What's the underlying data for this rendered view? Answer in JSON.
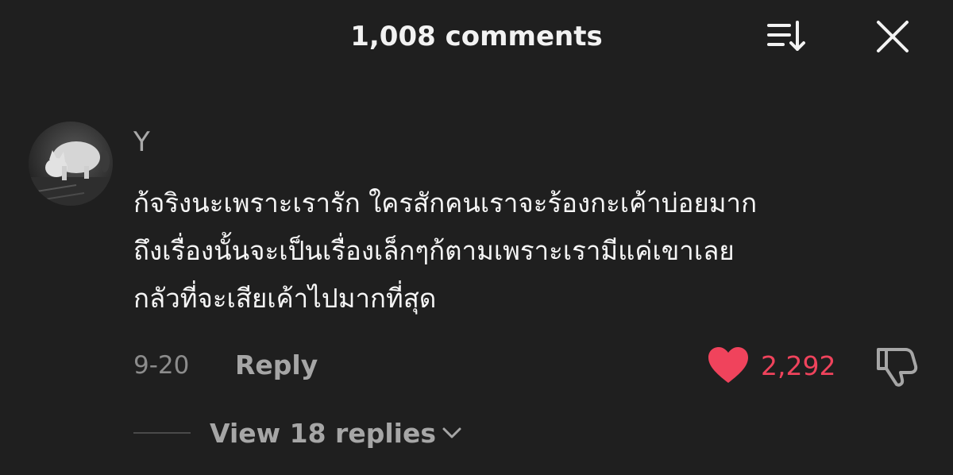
{
  "header": {
    "title": "1,008 comments",
    "sort_icon": "sort-icon",
    "close_icon": "close-icon"
  },
  "comment": {
    "avatar_icon": "cat-avatar",
    "username": "Y",
    "text": "ก้จริงนะเพราะเรารัก ใครสักคนเราจะร้องกะเค้าบ่อยมาก\nถึงเรื่องนั้นจะเป็นเรื่องเล็กๆก้ตามเพราะเรามีแค่เขาเลย\nกลัวที่จะเสียเค้าไปมากที่สุด",
    "date": "9-20",
    "reply_label": "Reply",
    "like_count": "2,292",
    "like_icon": "heart-icon",
    "dislike_icon": "thumbs-down-icon"
  },
  "replies": {
    "label": "View 18 replies",
    "chevron_icon": "chevron-down-icon"
  },
  "colors": {
    "background": "#1f1f1f",
    "like_accent": "#f0435c",
    "muted_text": "#a6a6a6"
  }
}
